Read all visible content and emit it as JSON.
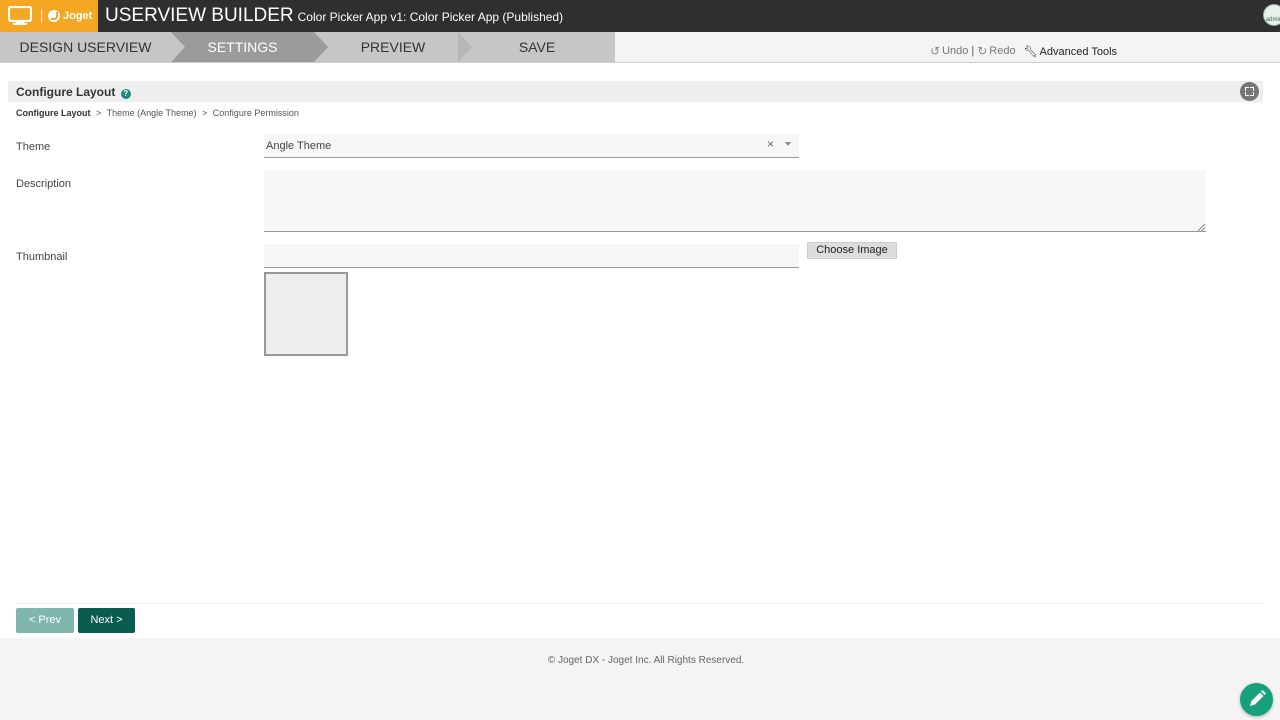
{
  "header": {
    "title": "USERVIEW BUILDER",
    "subtitle": "Color Picker App v1: Color Picker App (Published)",
    "logo_text": "Joget",
    "avatar_text": "admin"
  },
  "steps": [
    {
      "label": "DESIGN USERVIEW",
      "active": false
    },
    {
      "label": "SETTINGS",
      "active": true
    },
    {
      "label": "PREVIEW",
      "active": false
    },
    {
      "label": "SAVE",
      "active": false
    }
  ],
  "tools": {
    "undo": "Undo",
    "separator": "|",
    "redo": "Redo",
    "advanced": "Advanced Tools"
  },
  "panel": {
    "title": "Configure Layout"
  },
  "breadcrumb": {
    "current": "Configure Layout",
    "sep": ">",
    "item2": "Theme (Angle Theme)",
    "item3": "Configure Permission"
  },
  "form": {
    "theme_label": "Theme",
    "theme_value": "Angle Theme",
    "clear_glyph": "×",
    "description_label": "Description",
    "description_value": "",
    "thumbnail_label": "Thumbnail",
    "thumbnail_value": "",
    "choose_image": "Choose Image"
  },
  "nav": {
    "prev": "< Prev",
    "next": "Next >"
  },
  "footer": {
    "text": "© Joget DX - Joget Inc. All Rights Reserved."
  },
  "colors": {
    "accent": "#f5a623",
    "topbar": "#2f2f2f",
    "primary_button": "#0a5c50",
    "fab": "#17a17a"
  }
}
